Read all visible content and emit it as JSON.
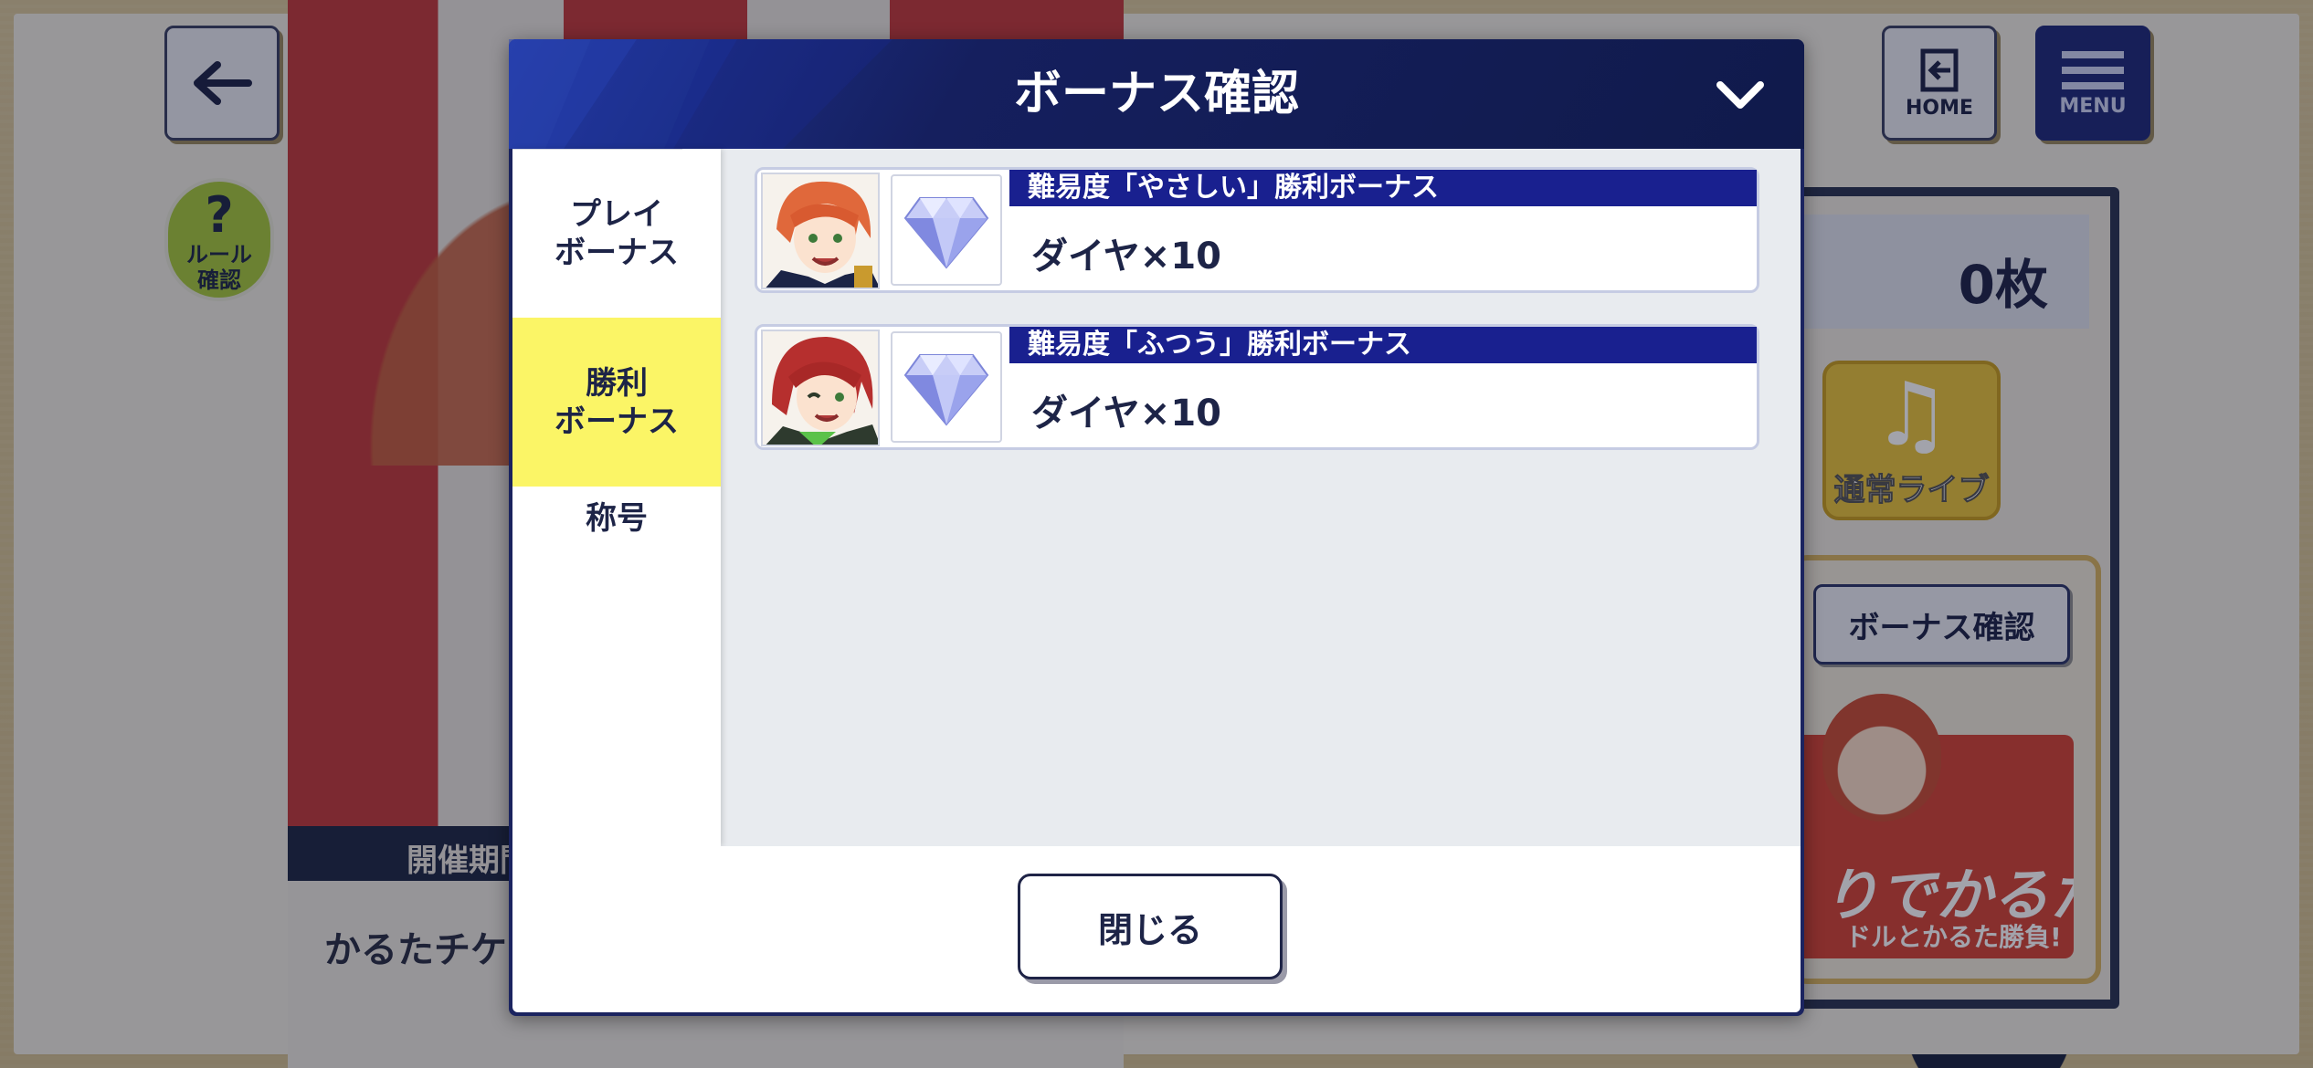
{
  "background": {
    "event_period_label": "開催期間",
    "ticket_label": "かるたチケ",
    "coin_count": "0枚",
    "normal_live_label": "通常ライブ",
    "bonus_check_button": "ボーナス確認",
    "promo_title": "りでかるた!",
    "promo_subtitle": "ドルとかるた勝負!",
    "rule_button": {
      "line1": "ルール",
      "line2": "確認"
    },
    "home_button": "HOME",
    "menu_button": "MENU"
  },
  "modal": {
    "title": "ボーナス確認",
    "tabs": [
      {
        "label": "プレイ\nボーナス",
        "active": false
      },
      {
        "label": "勝利\nボーナス",
        "active": true
      },
      {
        "label": "称号",
        "active": false
      }
    ],
    "rewards": [
      {
        "title": "難易度「やさしい」勝利ボーナス",
        "value": "ダイヤ×10",
        "item_icon": "diamond-icon"
      },
      {
        "title": "難易度「ふつう」勝利ボーナス",
        "value": "ダイヤ×10",
        "item_icon": "diamond-icon"
      }
    ],
    "close_button": "閉じる"
  },
  "colors": {
    "modal_header": "#101a4b",
    "reward_title_bar": "#19208f",
    "active_tab": "#fbf566"
  }
}
